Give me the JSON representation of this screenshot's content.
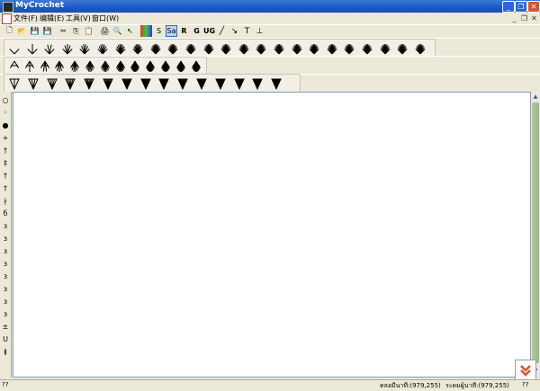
{
  "window": {
    "title": "MyCrochet"
  },
  "menu": [
    "文件(F)",
    "编辑(E)",
    "工具(V)",
    "窗口(W)"
  ],
  "toolbar1": {
    "std": [
      "new",
      "open",
      "save",
      "save-as",
      "cut",
      "copy",
      "paste",
      "print",
      "print-preview",
      "pointer",
      "color",
      "select-text",
      "select-all"
    ],
    "letters": [
      "R",
      "G",
      "UG"
    ],
    "tools": [
      "line",
      "arrow",
      "T",
      "sign"
    ]
  },
  "stitch_counts": {
    "row1_right": 24,
    "row2": 13,
    "row3": 15
  },
  "left_symbols": [
    "○",
    "◦",
    "●",
    "+",
    "†",
    "‡",
    "†",
    "†",
    "∤",
    "б",
    "з",
    "з",
    "з",
    "з",
    "з",
    "з",
    "з",
    "з",
    "±",
    "U",
    "≬"
  ],
  "status": {
    "left": "??",
    "pos1": "ตลอมีนาที:(979,255)",
    "pos2": "ระดมผู้นาที:(979,255)",
    "end": "??"
  },
  "colors": {
    "title_blue": "#1c58c9",
    "chrome": "#ece9d8",
    "scroll_green": "#9bb784",
    "accent_red": "#d9532e"
  }
}
